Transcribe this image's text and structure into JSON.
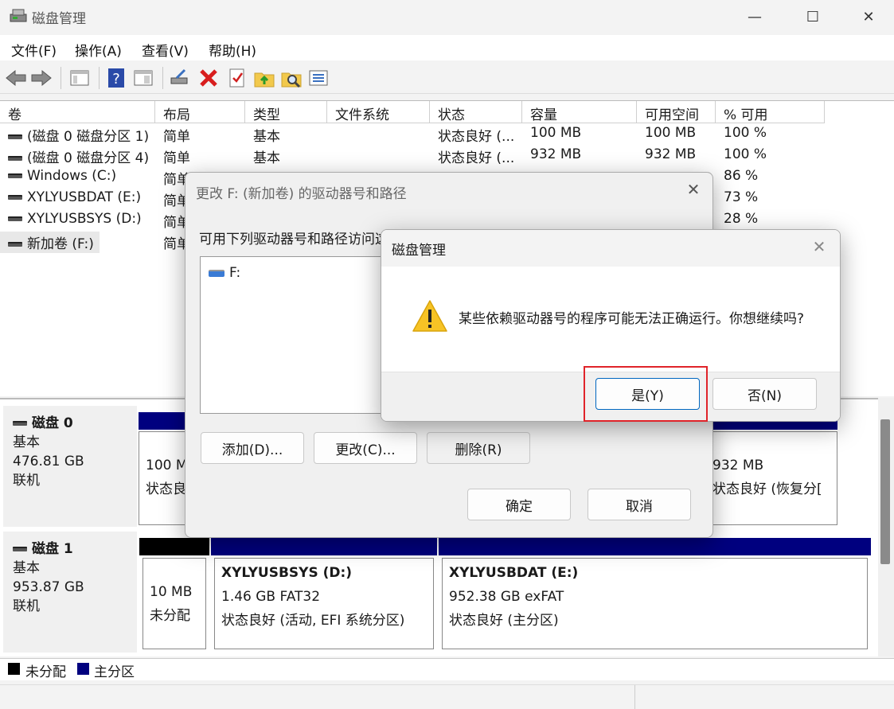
{
  "window": {
    "title": "磁盘管理",
    "minimize": "—",
    "maximize": "☐",
    "close": "✕"
  },
  "menu": [
    "文件(F)",
    "操作(A)",
    "查看(V)",
    "帮助(H)"
  ],
  "volumes": {
    "headers": [
      "卷",
      "布局",
      "类型",
      "文件系统",
      "状态",
      "容量",
      "可用空间",
      "% 可用"
    ],
    "rows": [
      {
        "name": "(磁盘 0 磁盘分区 1)",
        "layout": "简单",
        "type": "基本",
        "fs": "",
        "status": "状态良好 (...",
        "capacity": "100 MB",
        "free": "100 MB",
        "pct": "100 %"
      },
      {
        "name": "(磁盘 0 磁盘分区 4)",
        "layout": "简单",
        "type": "基本",
        "fs": "",
        "status": "状态良好 (...",
        "capacity": "932 MB",
        "free": "932 MB",
        "pct": "100 %"
      },
      {
        "name": "Windows (C:)",
        "layout": "简单",
        "type": "基本",
        "fs": "",
        "status": "",
        "capacity": "",
        "free": "",
        "pct": "86 %"
      },
      {
        "name": "XYLYUSBDAT (E:)",
        "layout": "简单",
        "type": "",
        "fs": "",
        "status": "",
        "capacity": "",
        "free": "",
        "pct": "73 %"
      },
      {
        "name": "XYLYUSBSYS (D:)",
        "layout": "简单",
        "type": "",
        "fs": "",
        "status": "",
        "capacity": "",
        "free": "",
        "pct": "28 %"
      },
      {
        "name": "新加卷 (F:)",
        "layout": "简单",
        "type": "",
        "fs": "",
        "status": "",
        "capacity": "",
        "free": "",
        "pct": ""
      }
    ]
  },
  "disk0": {
    "name": "磁盘 0",
    "type": "基本",
    "size": "476.81 GB",
    "state": "联机",
    "p1": {
      "size": "100 M",
      "status": "状态良"
    },
    "p_last": {
      "size": "932 MB",
      "status": "状态良好 (恢复分["
    }
  },
  "disk1": {
    "name": "磁盘 1",
    "type": "基本",
    "size": "953.87 GB",
    "state": "联机",
    "unalloc": {
      "size": "10 MB",
      "status": "未分配"
    },
    "sys": {
      "name": "XYLYUSBSYS  (D:)",
      "size": "1.46 GB FAT32",
      "status": "状态良好 (活动, EFI 系统分区)"
    },
    "dat": {
      "name": "XYLYUSBDAT  (E:)",
      "size": "952.38 GB exFAT",
      "status": "状态良好 (主分区)"
    }
  },
  "legend": {
    "unallocated": "未分配",
    "primary": "主分区"
  },
  "dialog_paths": {
    "title": "更改 F: (新加卷) 的驱动器号和路径",
    "prompt": "可用下列驱动器号和路径访问这个卷(A):",
    "entry": "F:",
    "add": "添加(D)...",
    "change": "更改(C)...",
    "remove": "删除(R)",
    "ok": "确定",
    "cancel": "取消"
  },
  "dialog_confirm": {
    "title": "磁盘管理",
    "message": "某些依赖驱动器号的程序可能无法正确运行。你想继续吗?",
    "yes": "是(Y)",
    "no": "否(N)"
  },
  "colors": {
    "primary_partition": "#00007f",
    "unallocated": "#000000",
    "highlight": "#e0242a"
  }
}
